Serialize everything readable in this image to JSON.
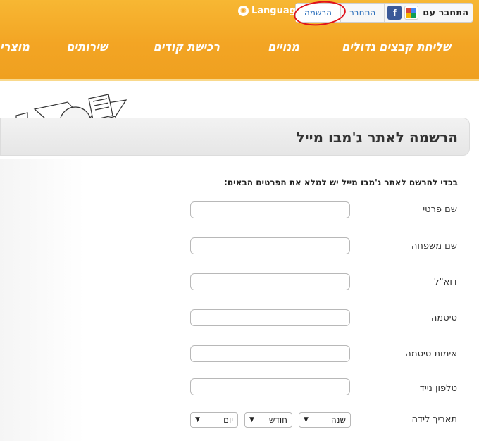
{
  "topbar": {
    "connect_with": "התחבר עם",
    "login": "התחבר",
    "register": "הרשמה",
    "language": "Language",
    "fb_letter": "f",
    "google_letter": "g"
  },
  "nav": {
    "items": [
      "שליחת קבצים גדולים",
      "מנויים",
      "רכישת קודים",
      "שירותים",
      "מוצרים"
    ]
  },
  "page": {
    "title": "הרשמה לאתר ג'מבו מייל",
    "intro": "בכדי להרשם לאתר ג'מבו מייל יש למלא את הפרטים הבאים:"
  },
  "form": {
    "first_name_label": "שם פרטי",
    "last_name_label": "שם משפחה",
    "email_label": "דוא\"ל",
    "password_label": "סיסמה",
    "confirm_password_label": "אימות סיסמה",
    "phone_label": "טלפון נייד",
    "birthdate_label": "תאריך לידה",
    "year_select": "שנה",
    "month_select": "חודש",
    "day_select": "יום"
  },
  "colors": {
    "header": "#f3a524",
    "link": "#2a6ebb",
    "annotation_circle": "#e0121b"
  },
  "icons": {
    "facebook": "facebook-icon",
    "google": "google-icon",
    "language": "globe-icon",
    "dropdown": "chevron-down-icon"
  }
}
